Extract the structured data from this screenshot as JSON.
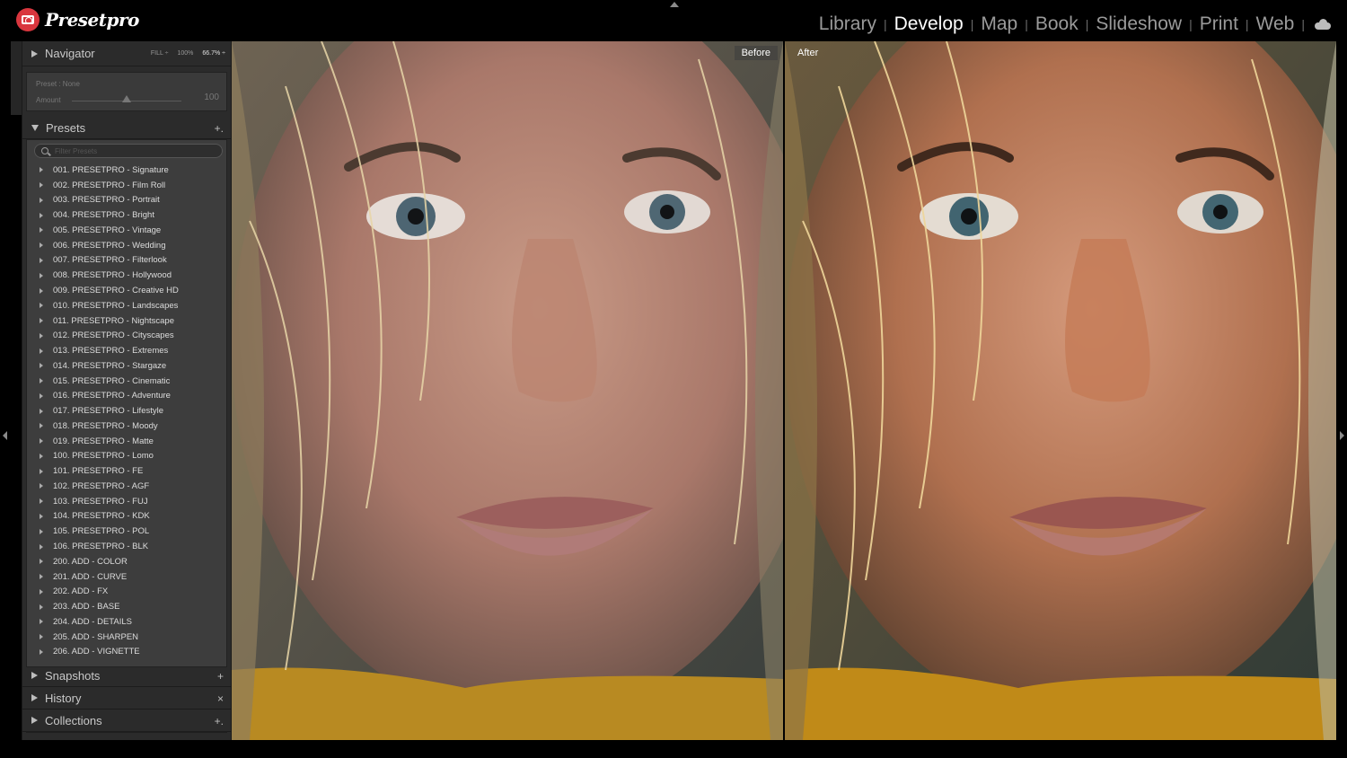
{
  "app": {
    "logo_text": "Presetpro"
  },
  "modules": [
    "Library",
    "Develop",
    "Map",
    "Book",
    "Slideshow",
    "Print",
    "Web"
  ],
  "active_module": "Develop",
  "navigator": {
    "label": "Navigator",
    "fill": "FILL ÷",
    "z100": "100%",
    "z667": "66.7% ÷"
  },
  "preset_amount": {
    "preset_label": "Preset : None",
    "amount_label": "Amount",
    "amount_value": "100",
    "amount_level": 0.5
  },
  "presets": {
    "label": "Presets",
    "add": "+.",
    "filter_placeholder": "Filter Presets",
    "items": [
      "001. PRESETPRO - Signature",
      "002. PRESETPRO - Film Roll",
      "003. PRESETPRO - Portrait",
      "004. PRESETPRO - Bright",
      "005. PRESETPRO - Vintage",
      "006. PRESETPRO - Wedding",
      "007. PRESETPRO - Filterlook",
      "008. PRESETPRO - Hollywood",
      "009. PRESETPRO - Creative HD",
      "010. PRESETPRO - Landscapes",
      "011. PRESETPRO - Nightscape",
      "012. PRESETPRO - Cityscapes",
      "013. PRESETPRO - Extremes",
      "014. PRESETPRO - Stargaze",
      "015. PRESETPRO - Cinematic",
      "016. PRESETPRO - Adventure",
      "017. PRESETPRO - Lifestyle",
      "018. PRESETPRO - Moody",
      "019. PRESETPRO - Matte",
      "100. PRESETPRO - Lomo",
      "101. PRESETPRO - FE",
      "102. PRESETPRO - AGF",
      "103. PRESETPRO - FUJ",
      "104. PRESETPRO - KDK",
      "105. PRESETPRO - POL",
      "106. PRESETPRO - BLK",
      "200. ADD - COLOR",
      "201. ADD - CURVE",
      "202. ADD - FX",
      "203. ADD - BASE",
      "204. ADD - DETAILS",
      "205. ADD - SHARPEN",
      "206. ADD - VIGNETTE"
    ]
  },
  "snapshots": {
    "label": "Snapshots",
    "action": "+"
  },
  "history": {
    "label": "History",
    "action": "×"
  },
  "collections": {
    "label": "Collections",
    "action": "+."
  },
  "compare": {
    "before_label": "Before",
    "after_label": "After"
  },
  "colors": {
    "accent": "#d9363e",
    "panel": "#2b2b2b",
    "list_bg": "#3d3d3d",
    "active_module": "#ffffff"
  }
}
